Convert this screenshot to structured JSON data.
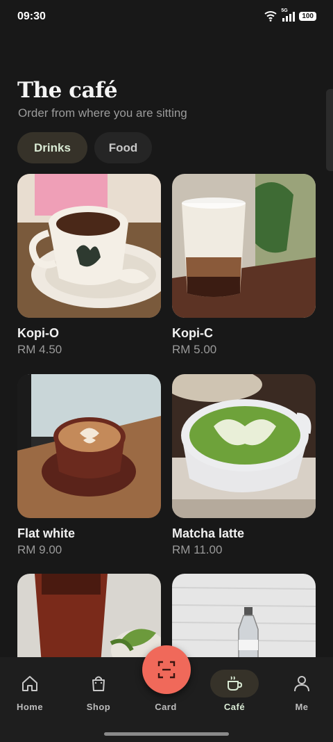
{
  "status_bar": {
    "time": "09:30",
    "network": "5G",
    "battery": "100"
  },
  "header": {
    "title": "The café",
    "subtitle": "Order from where you are sitting"
  },
  "filters": [
    {
      "label": "Drinks",
      "selected": true
    },
    {
      "label": "Food",
      "selected": false
    }
  ],
  "products": [
    {
      "name": "Kopi-O",
      "price": "RM 4.50"
    },
    {
      "name": "Kopi-C",
      "price": "RM 5.00"
    },
    {
      "name": "Flat white",
      "price": "RM 9.00"
    },
    {
      "name": "Matcha latte",
      "price": "RM 11.00"
    },
    {
      "name": "",
      "price": ""
    },
    {
      "name": "",
      "price": ""
    }
  ],
  "nav": {
    "items": [
      {
        "label": "Home",
        "icon": "home-icon"
      },
      {
        "label": "Shop",
        "icon": "shopping-bag-icon"
      },
      {
        "label": "Card",
        "icon": "scan-icon"
      },
      {
        "label": "Café",
        "icon": "coffee-cup-icon",
        "active": true
      },
      {
        "label": "Me",
        "icon": "person-icon"
      }
    ]
  },
  "colors": {
    "background": "#181818",
    "accent": "#f0695a",
    "chip_selected": "#363229",
    "active_text": "#d9ead4"
  }
}
